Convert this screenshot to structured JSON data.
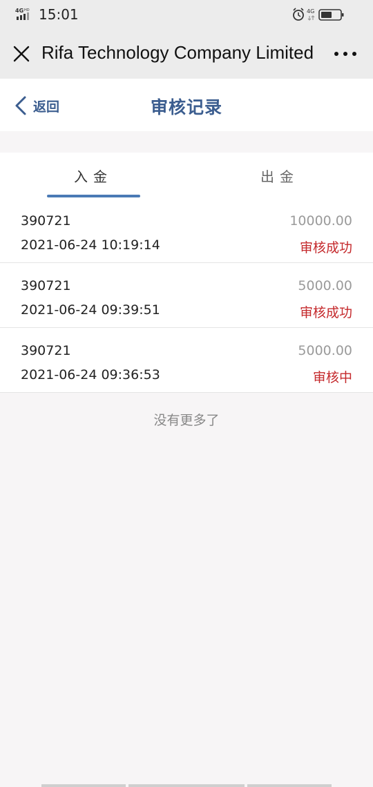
{
  "status_bar": {
    "network_label": "4GHD",
    "time": "15:01",
    "network_right": "4G"
  },
  "wx_header": {
    "title": "Rifa Technology Company Limited",
    "close_icon": "close-icon",
    "more_icon": "more-dots-icon"
  },
  "nav": {
    "back_label": "返回",
    "title": "审核记录"
  },
  "tabs": [
    {
      "label": "入金",
      "active": true
    },
    {
      "label": "出金",
      "active": false
    }
  ],
  "records": [
    {
      "account": "390721",
      "amount": "10000.00",
      "time": "2021-06-24 10:19:14",
      "status": "审核成功"
    },
    {
      "account": "390721",
      "amount": "5000.00",
      "time": "2021-06-24 09:39:51",
      "status": "审核成功"
    },
    {
      "account": "390721",
      "amount": "5000.00",
      "time": "2021-06-24 09:36:53",
      "status": "审核中"
    }
  ],
  "footer": {
    "no_more": "没有更多了"
  },
  "colors": {
    "accent": "#3b5d8f",
    "tab_indicator": "#4a7ab5",
    "status_red": "#c4282b",
    "amount_gray": "#9a9a9a"
  }
}
